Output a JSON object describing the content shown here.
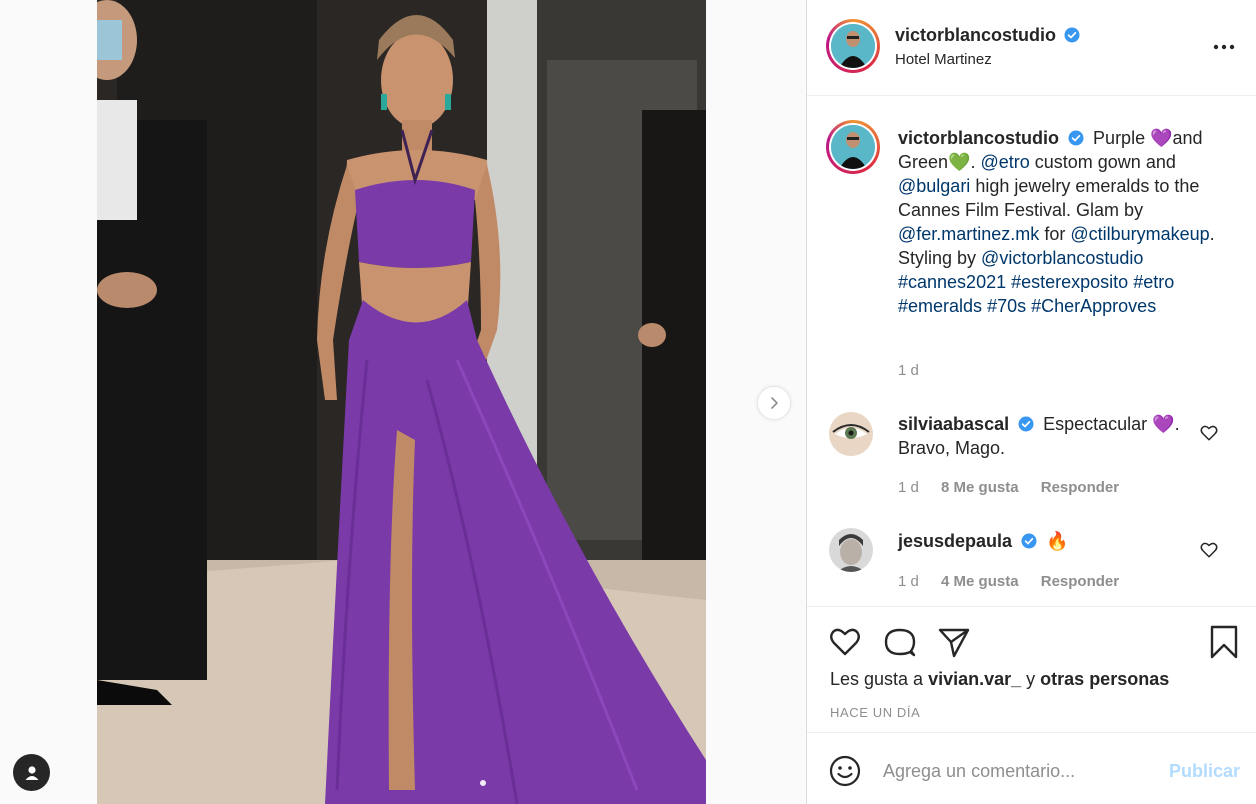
{
  "post": {
    "author": "victorblancostudio",
    "location": "Hotel Martinez",
    "caption_parts": [
      {
        "type": "text",
        "value": "Purple "
      },
      {
        "type": "emoji",
        "value": "💜"
      },
      {
        "type": "text",
        "value": "and Green"
      },
      {
        "type": "emoji",
        "value": "💚"
      },
      {
        "type": "text",
        "value": ". "
      },
      {
        "type": "tag",
        "value": "@etro"
      },
      {
        "type": "text",
        "value": " custom gown and "
      },
      {
        "type": "tag",
        "value": "@bulgari"
      },
      {
        "type": "text",
        "value": " high jewelry emeralds to the Cannes Film Festival. Glam by "
      },
      {
        "type": "tag",
        "value": "@fer.martinez.mk"
      },
      {
        "type": "text",
        "value": " for "
      },
      {
        "type": "tag",
        "value": "@ctilburymakeup"
      },
      {
        "type": "text",
        "value": ". Styling by "
      },
      {
        "type": "tag",
        "value": "@victorblancostudio"
      },
      {
        "type": "text",
        "value": " "
      },
      {
        "type": "tag",
        "value": "#cannes2021"
      },
      {
        "type": "text",
        "value": " "
      },
      {
        "type": "tag",
        "value": "#esterexposito"
      },
      {
        "type": "text",
        "value": " "
      },
      {
        "type": "tag",
        "value": "#etro"
      },
      {
        "type": "text",
        "value": " "
      },
      {
        "type": "tag",
        "value": "#emeralds"
      },
      {
        "type": "text",
        "value": " "
      },
      {
        "type": "tag",
        "value": "#70s"
      },
      {
        "type": "text",
        "value": " "
      },
      {
        "type": "tag",
        "value": "#CherApproves"
      }
    ],
    "caption_time": "1 d",
    "image_count": 2
  },
  "comments": [
    {
      "user": "silviaabascal",
      "text": "Espectacular 💜. Bravo, Mago.",
      "time": "1 d",
      "likes": "8 Me gusta",
      "reply": "Responder"
    },
    {
      "user": "jesusdepaula",
      "text": "🔥",
      "time": "1 d",
      "likes": "4 Me gusta",
      "reply": "Responder"
    }
  ],
  "likes_line": {
    "prefix": "Les gusta a ",
    "user": "vivian.var_",
    "middle": " y ",
    "others": "otras personas"
  },
  "posted_ago": "HACE UN DÍA",
  "add_comment": {
    "placeholder": "Agrega un comentario...",
    "publish": "Publicar"
  },
  "icons": {
    "more": "more-options-icon",
    "verified": "verified-badge-icon",
    "next": "chevron-right-icon",
    "like": "heart-icon",
    "comment": "comment-icon",
    "share": "paper-plane-icon",
    "save": "bookmark-icon",
    "emoji": "smiley-icon",
    "profile": "user-icon"
  },
  "colors": {
    "link": "#00376b",
    "verified": "#3897f0",
    "publish_disabled": "#b3dbff",
    "gown": "#7a3aa8"
  }
}
